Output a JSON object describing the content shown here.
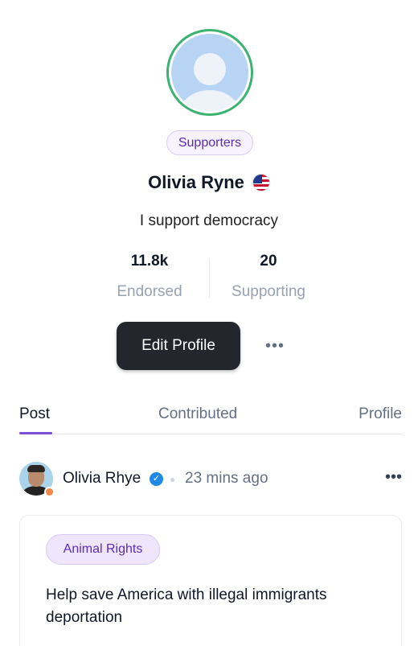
{
  "profile": {
    "badge": "Supporters",
    "name": "Olivia Ryne",
    "bio": "I support democracy"
  },
  "stats": {
    "endorsed": {
      "value": "11.8k",
      "label": "Endorsed"
    },
    "supporting": {
      "value": "20",
      "label": "Supporting"
    }
  },
  "actions": {
    "edit_label": "Edit Profile",
    "more_label": "•••"
  },
  "tabs": [
    {
      "label": "Post",
      "active": true
    },
    {
      "label": "Contributed",
      "active": false
    },
    {
      "label": "Profile",
      "active": false
    }
  ],
  "post": {
    "author": "Olivia Rhye",
    "time": "23 mins ago",
    "more_label": "•••",
    "tag": "Animal Rights",
    "text": "Help save America with illegal immigrants deportation"
  },
  "colors": {
    "accent": "#7c4fd6",
    "avatar_ring": "#3cb371",
    "online": "#f38744",
    "verified": "#1e88e5"
  }
}
